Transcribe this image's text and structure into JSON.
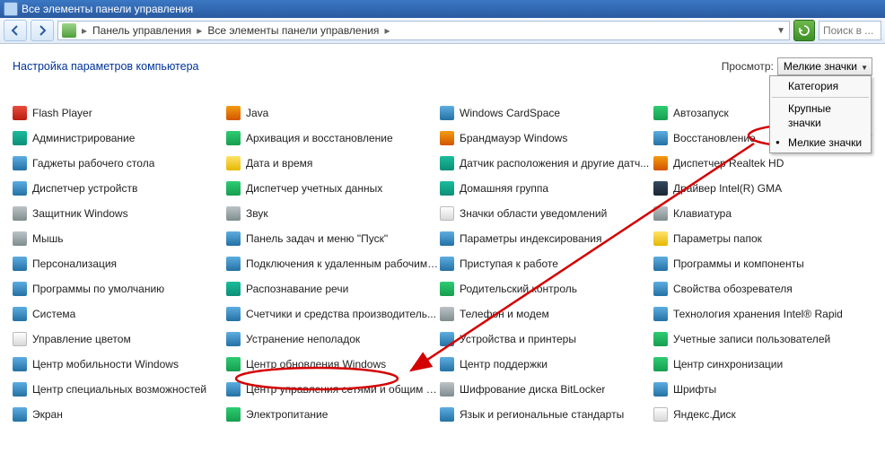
{
  "titlebar": {
    "text": "Все элементы панели управления"
  },
  "address": {
    "crumb1": "Панель управления",
    "crumb2": "Все элементы панели управления"
  },
  "search": {
    "placeholder": "Поиск в ..."
  },
  "heading": "Настройка параметров компьютера",
  "view": {
    "label": "Просмотр:",
    "current": "Мелкие значки",
    "opt_category": "Категория",
    "opt_large": "Крупные значки",
    "opt_small": "Мелкие значки"
  },
  "items": [
    {
      "label": "Flash Player",
      "icon": "ic-red",
      "name": "cp-flash-player"
    },
    {
      "label": "Java",
      "icon": "ic-orange",
      "name": "cp-java"
    },
    {
      "label": "Windows CardSpace",
      "icon": "ic-blue",
      "name": "cp-cardspace"
    },
    {
      "label": "Автозапуск",
      "icon": "ic-green",
      "name": "cp-autoplay"
    },
    {
      "label": "Администрирование",
      "icon": "ic-teal",
      "name": "cp-admin-tools"
    },
    {
      "label": "Архивация и восстановление",
      "icon": "ic-green",
      "name": "cp-backup-restore"
    },
    {
      "label": "Брандмауэр Windows",
      "icon": "ic-orange",
      "name": "cp-firewall"
    },
    {
      "label": "Восстановление",
      "icon": "ic-blue",
      "name": "cp-recovery"
    },
    {
      "label": "Гаджеты рабочего стола",
      "icon": "ic-blue",
      "name": "cp-gadgets"
    },
    {
      "label": "Дата и время",
      "icon": "ic-yellow",
      "name": "cp-datetime"
    },
    {
      "label": "Датчик расположения и другие датч...",
      "icon": "ic-teal",
      "name": "cp-sensors"
    },
    {
      "label": "Диспетчер Realtek HD",
      "icon": "ic-orange",
      "name": "cp-realtek"
    },
    {
      "label": "Диспетчер устройств",
      "icon": "ic-blue",
      "name": "cp-device-manager"
    },
    {
      "label": "Диспетчер учетных данных",
      "icon": "ic-green",
      "name": "cp-credentials"
    },
    {
      "label": "Домашняя группа",
      "icon": "ic-teal",
      "name": "cp-homegroup"
    },
    {
      "label": "Драйвер Intel(R) GMA",
      "icon": "ic-navy",
      "name": "cp-intel-gma"
    },
    {
      "label": "Защитник Windows",
      "icon": "ic-grey",
      "name": "cp-defender"
    },
    {
      "label": "Звук",
      "icon": "ic-grey",
      "name": "cp-sound"
    },
    {
      "label": "Значки области уведомлений",
      "icon": "ic-white",
      "name": "cp-notification-icons"
    },
    {
      "label": "Клавиатура",
      "icon": "ic-grey",
      "name": "cp-keyboard"
    },
    {
      "label": "Мышь",
      "icon": "ic-grey",
      "name": "cp-mouse"
    },
    {
      "label": "Панель задач и меню \"Пуск\"",
      "icon": "ic-blue",
      "name": "cp-taskbar"
    },
    {
      "label": "Параметры индексирования",
      "icon": "ic-blue",
      "name": "cp-indexing"
    },
    {
      "label": "Параметры папок",
      "icon": "ic-yellow",
      "name": "cp-folder-options"
    },
    {
      "label": "Персонализация",
      "icon": "ic-blue",
      "name": "cp-personalization"
    },
    {
      "label": "Подключения к удаленным рабочим с...",
      "icon": "ic-blue",
      "name": "cp-remote-desktop"
    },
    {
      "label": "Приступая к работе",
      "icon": "ic-blue",
      "name": "cp-getting-started"
    },
    {
      "label": "Программы и компоненты",
      "icon": "ic-blue",
      "name": "cp-programs"
    },
    {
      "label": "Программы по умолчанию",
      "icon": "ic-blue",
      "name": "cp-default-programs"
    },
    {
      "label": "Распознавание речи",
      "icon": "ic-teal",
      "name": "cp-speech"
    },
    {
      "label": "Родительский контроль",
      "icon": "ic-green",
      "name": "cp-parental"
    },
    {
      "label": "Свойства обозревателя",
      "icon": "ic-blue",
      "name": "cp-internet-options"
    },
    {
      "label": "Система",
      "icon": "ic-blue",
      "name": "cp-system"
    },
    {
      "label": "Счетчики и средства производитель...",
      "icon": "ic-blue",
      "name": "cp-performance"
    },
    {
      "label": "Телефон и модем",
      "icon": "ic-grey",
      "name": "cp-phone-modem"
    },
    {
      "label": "Технология хранения Intel® Rapid",
      "icon": "ic-blue",
      "name": "cp-intel-rapid"
    },
    {
      "label": "Управление цветом",
      "icon": "ic-white",
      "name": "cp-color-mgmt"
    },
    {
      "label": "Устранение неполадок",
      "icon": "ic-blue",
      "name": "cp-troubleshooting"
    },
    {
      "label": "Устройства и принтеры",
      "icon": "ic-blue",
      "name": "cp-devices-printers"
    },
    {
      "label": "Учетные записи пользователей",
      "icon": "ic-green",
      "name": "cp-user-accounts"
    },
    {
      "label": "Центр мобильности Windows",
      "icon": "ic-blue",
      "name": "cp-mobility"
    },
    {
      "label": "Центр обновления Windows",
      "icon": "ic-green",
      "name": "cp-windows-update"
    },
    {
      "label": "Центр поддержки",
      "icon": "ic-blue",
      "name": "cp-action-center"
    },
    {
      "label": "Центр синхронизации",
      "icon": "ic-green",
      "name": "cp-sync-center"
    },
    {
      "label": "Центр специальных возможностей",
      "icon": "ic-blue",
      "name": "cp-ease-of-access"
    },
    {
      "label": "Центр управления сетями и общим д...",
      "icon": "ic-blue",
      "name": "cp-network-sharing"
    },
    {
      "label": "Шифрование диска BitLocker",
      "icon": "ic-grey",
      "name": "cp-bitlocker"
    },
    {
      "label": "Шрифты",
      "icon": "ic-blue",
      "name": "cp-fonts"
    },
    {
      "label": "Экран",
      "icon": "ic-blue",
      "name": "cp-display"
    },
    {
      "label": "Электропитание",
      "icon": "ic-green",
      "name": "cp-power"
    },
    {
      "label": "Язык и региональные стандарты",
      "icon": "ic-blue",
      "name": "cp-region-language"
    },
    {
      "label": "Яндекс.Диск",
      "icon": "ic-white",
      "name": "cp-yandex-disk"
    }
  ]
}
